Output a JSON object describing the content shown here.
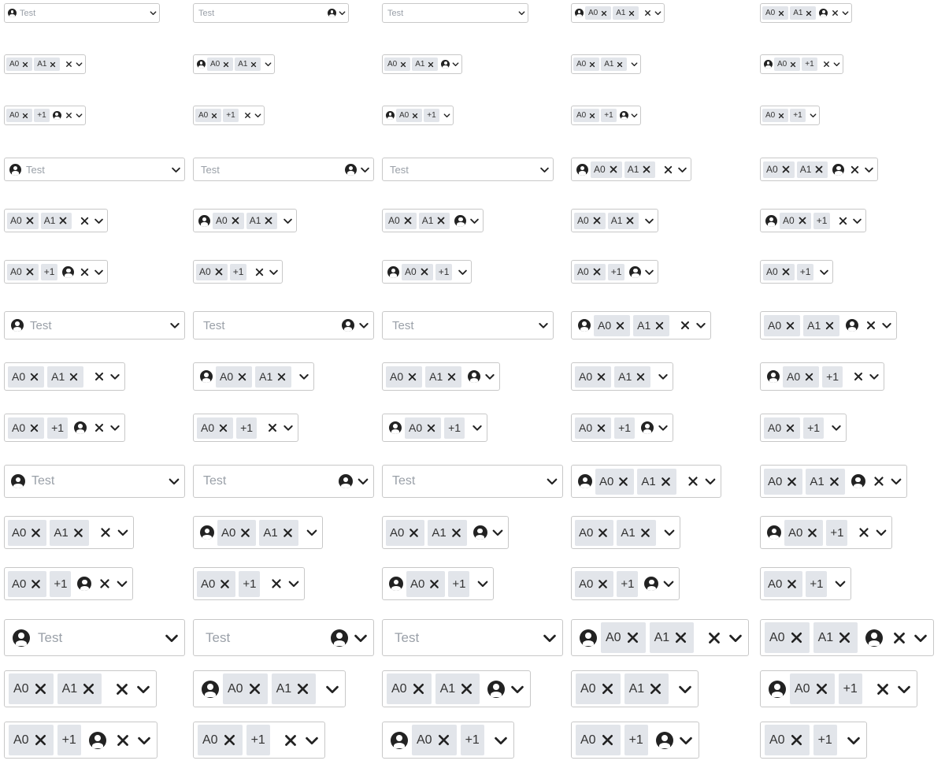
{
  "sample": {
    "placeholder": "Test",
    "chips": [
      "A0",
      "A1"
    ],
    "more_label": "+1"
  },
  "colors": {
    "border": "#c8c8c8",
    "chip_bg": "#e2e5ea",
    "placeholder": "#9aa0a8",
    "icon": "#222222"
  },
  "icons": {
    "avatar": "user-circle-icon",
    "chip_remove": "close-icon",
    "clear": "close-icon",
    "toggle": "chevron-down-icon"
  }
}
